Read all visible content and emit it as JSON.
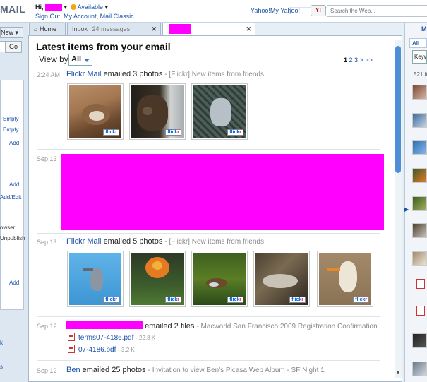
{
  "app": {
    "logo": "MAIL"
  },
  "user": {
    "greeting": "Hi,",
    "status": "Available"
  },
  "account_links": {
    "sign_out": "Sign Out,",
    "my_account": "My Account,",
    "mail_classic": "Mail Classic"
  },
  "top_links": {
    "yahoo": "Yahoo!",
    "my_yahoo": "My Yahoo!"
  },
  "search": {
    "placeholder": "Search the Web..."
  },
  "left": {
    "new_button": "New",
    "go_button": "Go",
    "items": [
      "Empty",
      "Empty",
      "Add",
      "Add",
      "Add/Edit",
      "owser",
      "Unpublish",
      "Add",
      "k",
      "s"
    ]
  },
  "tabs": [
    {
      "label": "Home"
    },
    {
      "label": "Inbox",
      "count": "24 messages"
    },
    {
      "label": ""
    }
  ],
  "main": {
    "heading": "Latest items from your email",
    "view_by_label": "View by",
    "view_by_value": "All",
    "pager": {
      "current": "1",
      "pages": [
        "2",
        "3"
      ],
      "next": ">",
      "last": ">>"
    }
  },
  "items": [
    {
      "date": "2:24 AM",
      "sender": "Flickr Mail",
      "action": "emailed 3 photos",
      "subject": "- [Flickr] New items from friends"
    },
    {
      "date": "Sep 13"
    },
    {
      "date": "Sep 13",
      "sender": "Flickr Mail",
      "action": "emailed 5 photos",
      "subject": "- [Flickr] New items from friends"
    },
    {
      "date": "Sep 12",
      "action": "emailed 2 files",
      "subject": "- Macworld San Francisco 2009 Registration Confirmation",
      "files": [
        {
          "name": "terms07-4186.pdf",
          "size": "- 22.8 K"
        },
        {
          "name": "07-4186.pdf",
          "size": "- 3.2 K"
        }
      ]
    },
    {
      "date": "Sep 12",
      "sender": "Ben",
      "action": "emailed 25 photos",
      "subject": "- Invitation to view Ben's Picasa Web Album - SF Night 1"
    }
  ],
  "right": {
    "all_tab": "All",
    "keyword": "Keyw",
    "count": "521 it",
    "top_label": "M"
  },
  "flickr_badge": {
    "a": "flick",
    "b": "r"
  },
  "colors": {
    "link": "#1a52a8",
    "redaction": "#ff00ff",
    "flickr_blue": "#0063dc",
    "flickr_pink": "#ff0084"
  }
}
